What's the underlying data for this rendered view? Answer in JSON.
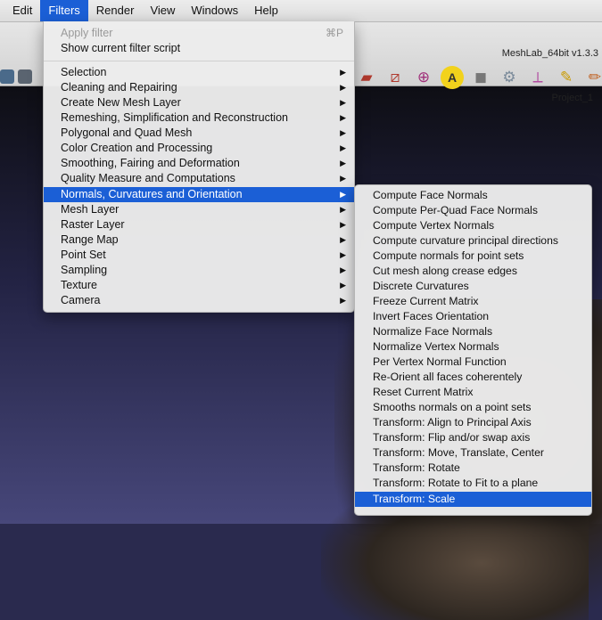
{
  "menubar": {
    "items": [
      "Edit",
      "Filters",
      "Render",
      "View",
      "Windows",
      "Help"
    ],
    "active": "Filters"
  },
  "window": {
    "app_title": "MeshLab_64bit v1.3.3",
    "project_label": "Project_1"
  },
  "filters_menu": {
    "apply_filter": "Apply filter",
    "apply_shortcut": "⌘P",
    "show_script": "Show current filter script",
    "items": [
      "Selection",
      "Cleaning and Repairing",
      "Create New Mesh Layer",
      "Remeshing, Simplification and Reconstruction",
      "Polygonal and Quad Mesh",
      "Color Creation and Processing",
      "Smoothing, Fairing and Deformation",
      "Quality Measure and Computations",
      "Normals, Curvatures and Orientation",
      "Mesh Layer",
      "Raster Layer",
      "Range Map",
      "Point Set",
      "Sampling",
      "Texture",
      "Camera"
    ],
    "highlighted": "Normals, Curvatures and Orientation"
  },
  "submenu": {
    "items": [
      "Compute Face Normals",
      "Compute Per-Quad Face Normals",
      "Compute Vertex Normals",
      "Compute curvature principal directions",
      "Compute normals for point sets",
      "Cut mesh along crease edges",
      "Discrete Curvatures",
      "Freeze Current Matrix",
      "Invert Faces Orientation",
      "Normalize Face Normals",
      "Normalize Vertex Normals",
      "Per Vertex Normal Function",
      "Re-Orient all faces coherentely",
      "Reset Current Matrix",
      "Smooths normals on a point sets",
      "Transform: Align to Principal Axis",
      "Transform: Flip and/or swap axis",
      "Transform: Move, Translate, Center",
      "Transform: Rotate",
      "Transform: Rotate to Fit to a plane",
      "Transform: Scale"
    ],
    "highlighted": "Transform: Scale"
  },
  "colors": {
    "highlight": "#1b5fd6",
    "menu_bg": "#ececec",
    "disabled_text": "#9a9a9a"
  },
  "toolbar_icons": [
    "brush-icon",
    "mesh-icon",
    "sphere-icon",
    "axis-a-icon",
    "square-icon",
    "gear-icon",
    "axes-icon",
    "paint-icon",
    "pencil-icon"
  ]
}
